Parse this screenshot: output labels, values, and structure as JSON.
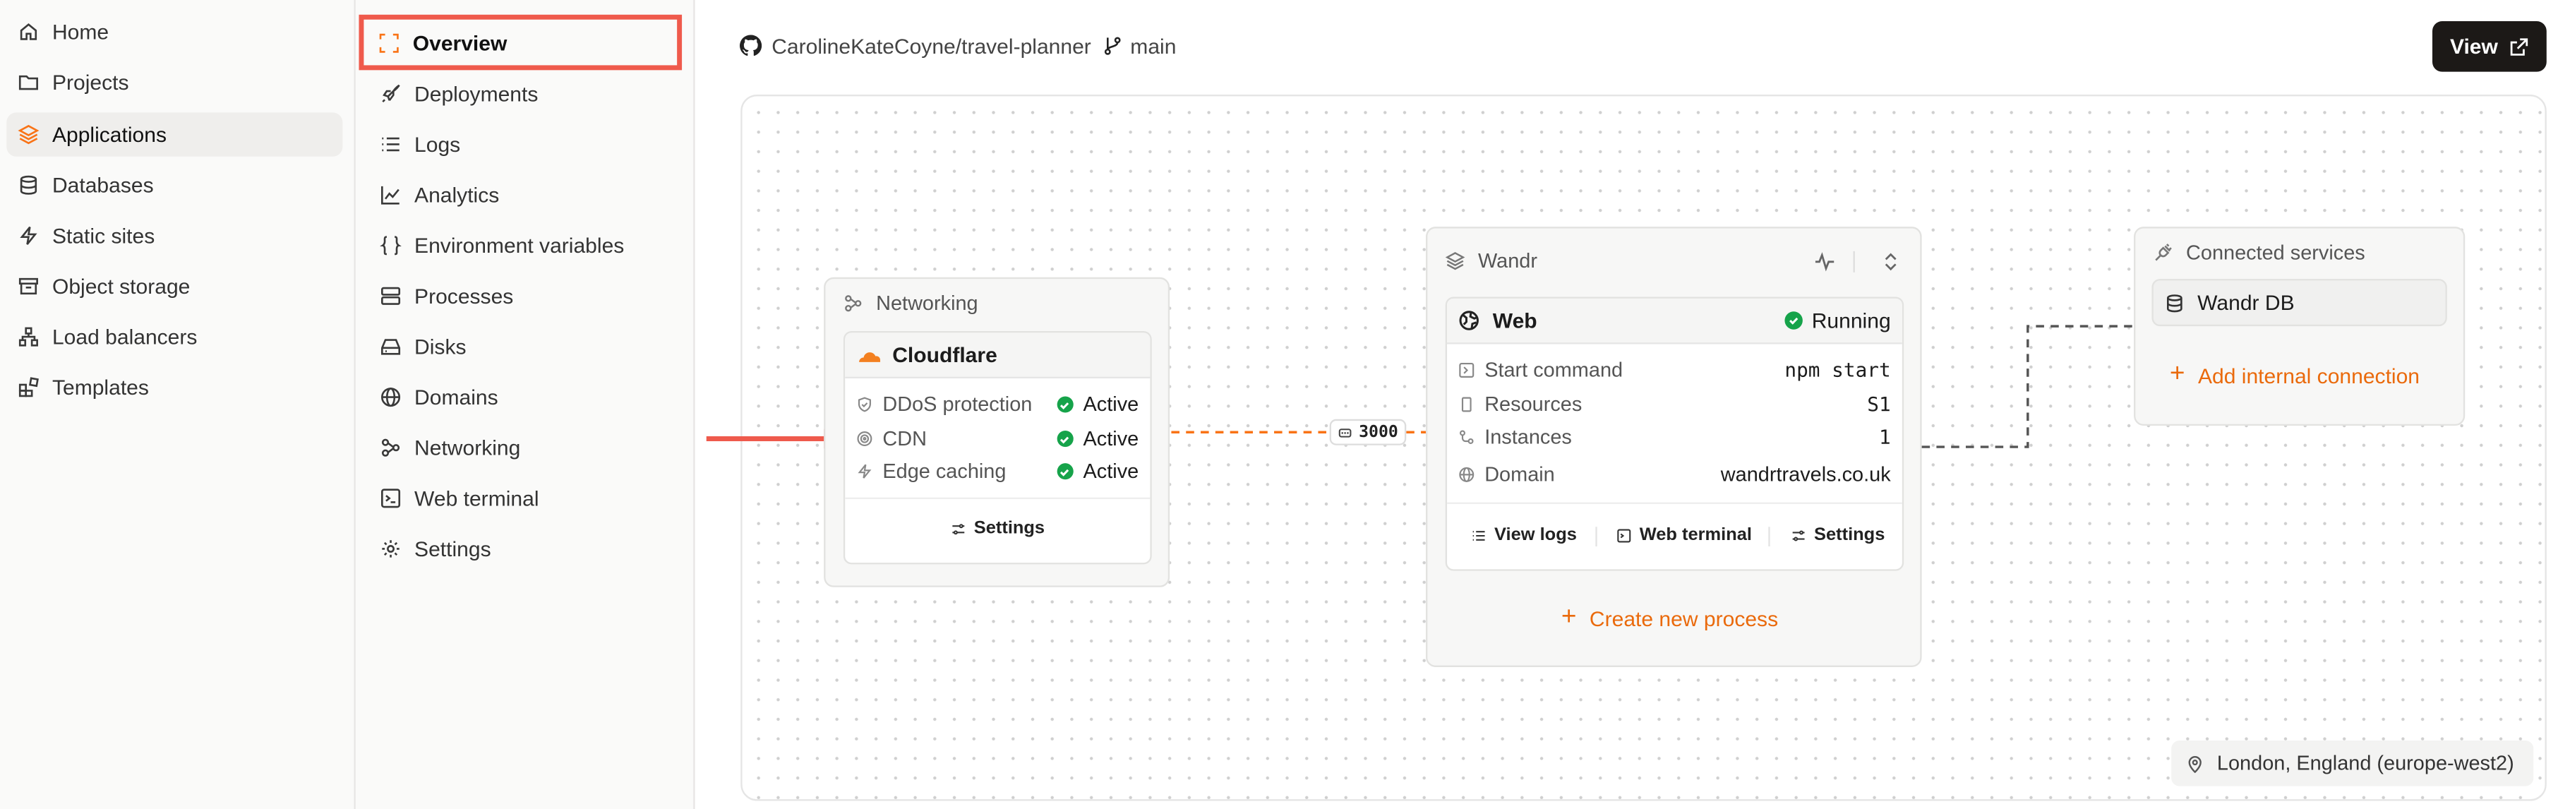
{
  "sidebar": {
    "items": [
      {
        "label": "Home",
        "icon": "home-icon"
      },
      {
        "label": "Projects",
        "icon": "folder-icon"
      },
      {
        "label": "Applications",
        "icon": "layers-icon",
        "active": true
      },
      {
        "label": "Databases",
        "icon": "database-icon"
      },
      {
        "label": "Static sites",
        "icon": "bolt-icon"
      },
      {
        "label": "Object storage",
        "icon": "archive-icon"
      },
      {
        "label": "Load balancers",
        "icon": "network-icon"
      },
      {
        "label": "Templates",
        "icon": "blocks-icon"
      }
    ]
  },
  "subnav": {
    "items": [
      {
        "label": "Overview",
        "icon": "overview-icon",
        "selected": true
      },
      {
        "label": "Deployments",
        "icon": "rocket-icon"
      },
      {
        "label": "Logs",
        "icon": "list-icon"
      },
      {
        "label": "Analytics",
        "icon": "chart-icon"
      },
      {
        "label": "Environment variables",
        "icon": "braces-icon"
      },
      {
        "label": "Processes",
        "icon": "server-icon"
      },
      {
        "label": "Disks",
        "icon": "disk-icon"
      },
      {
        "label": "Domains",
        "icon": "globe-icon"
      },
      {
        "label": "Networking",
        "icon": "networking-icon"
      },
      {
        "label": "Web terminal",
        "icon": "terminal-icon"
      },
      {
        "label": "Settings",
        "icon": "gear-icon"
      }
    ]
  },
  "header": {
    "repo": "CarolineKateCoyne/travel-planner",
    "branch": "main",
    "view_label": "View"
  },
  "networking": {
    "title": "Networking",
    "provider": "Cloudflare",
    "features": [
      {
        "label": "DDoS protection",
        "status": "Active"
      },
      {
        "label": "CDN",
        "status": "Active"
      },
      {
        "label": "Edge caching",
        "status": "Active"
      }
    ],
    "settings_label": "Settings"
  },
  "port": "3000",
  "app": {
    "title": "Wandr",
    "process_name": "Web",
    "process_status": "Running",
    "rows": [
      {
        "label": "Start command",
        "value": "npm start"
      },
      {
        "label": "Resources",
        "value": "S1"
      },
      {
        "label": "Instances",
        "value": "1"
      },
      {
        "label": "Domain",
        "value": "wandrtravels.co.uk"
      }
    ],
    "actions": {
      "logs": "View logs",
      "terminal": "Web terminal",
      "settings": "Settings"
    },
    "create_label": "Create new process"
  },
  "connected": {
    "title": "Connected services",
    "db_name": "Wandr DB",
    "add_label": "Add internal connection"
  },
  "location": "London, England (europe-west2)",
  "colors": {
    "accent": "#f97316",
    "success": "#16a34a",
    "highlight": "#ef5a4c"
  }
}
